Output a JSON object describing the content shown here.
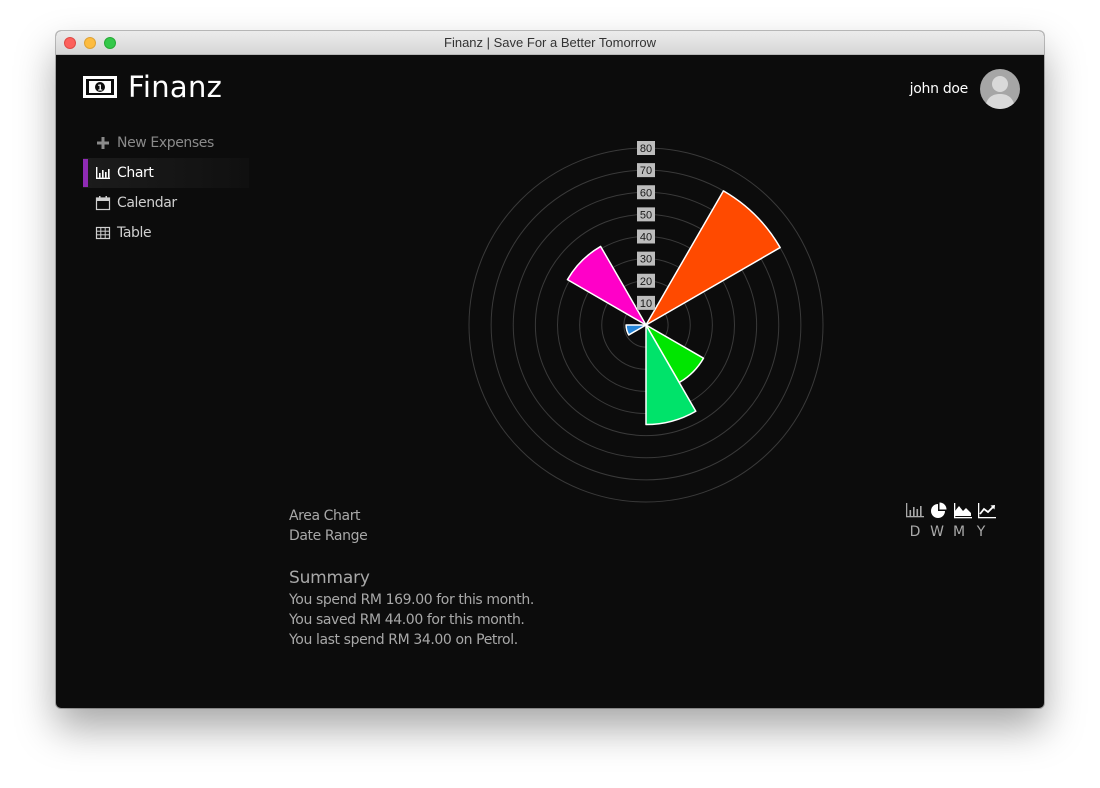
{
  "window": {
    "title": "Finanz | Save For a Better Tomorrow"
  },
  "app": {
    "logo_text": "Finanz",
    "logo_icon": "banknote-icon"
  },
  "user": {
    "name": "john doe",
    "avatar_icon": "user-silhouette-icon"
  },
  "nav": {
    "items": [
      {
        "label": "New Expenses",
        "icon": "plus-icon",
        "active": false
      },
      {
        "label": "Chart",
        "icon": "bar-chart-icon",
        "active": true
      },
      {
        "label": "Calendar",
        "icon": "calendar-icon",
        "active": false
      },
      {
        "label": "Table",
        "icon": "table-icon",
        "active": false
      }
    ],
    "active_color": "#8f2bb5"
  },
  "chart_data": {
    "type": "polar-area",
    "radial_ticks": [
      10,
      20,
      30,
      40,
      50,
      60,
      70,
      80
    ],
    "rmax": 80,
    "sectors": [
      {
        "start_deg": 30,
        "end_deg": 60,
        "value": 70,
        "color": "#ff4a00"
      },
      {
        "start_deg": 120,
        "end_deg": 150,
        "value": 30,
        "color": "#00e600"
      },
      {
        "start_deg": 150,
        "end_deg": 180,
        "value": 45,
        "color": "#00e36a"
      },
      {
        "start_deg": 240,
        "end_deg": 270,
        "value": 9,
        "color": "#2585d8"
      },
      {
        "start_deg": 300,
        "end_deg": 330,
        "value": 41,
        "color": "#ff00c8"
      }
    ]
  },
  "chart_controls": {
    "type_label": "Area Chart",
    "range_label": "Date Range",
    "chart_type_icons": [
      "bar-chart-icon",
      "pie-chart-icon",
      "area-chart-icon",
      "line-chart-icon"
    ],
    "ranges": [
      "D",
      "W",
      "M",
      "Y"
    ]
  },
  "summary": {
    "title": "Summary",
    "lines": [
      "You spend RM 169.00 for this month.",
      "You saved RM 44.00 for this month.",
      "You last spend RM 34.00 on Petrol."
    ]
  }
}
